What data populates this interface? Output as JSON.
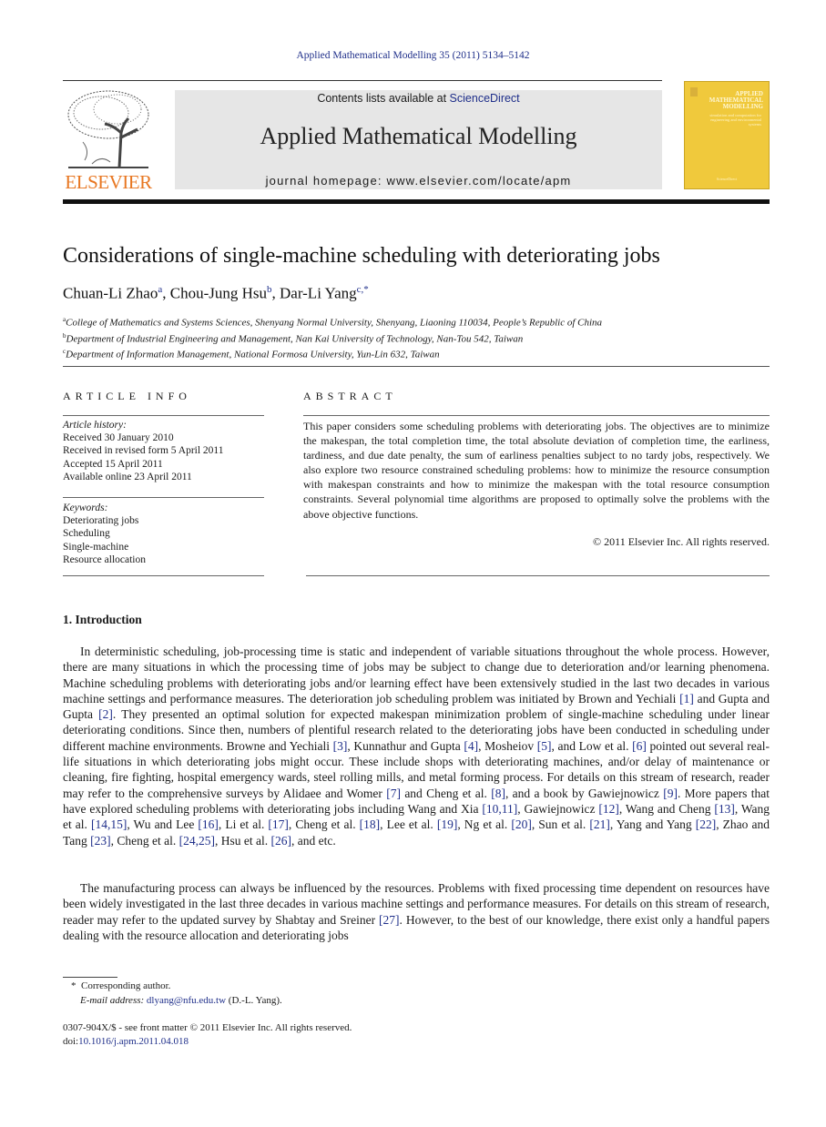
{
  "running_head": "Applied Mathematical Modelling 35 (2011) 5134–5142",
  "publisher_logo": {
    "text": "ELSEVIER",
    "icon": "elsevier-tree-icon",
    "color": "#e87722"
  },
  "banner": {
    "contents_prefix": "Contents lists available at ",
    "contents_link": "ScienceDirect",
    "journal_title": "Applied Mathematical Modelling",
    "homepage": "journal homepage: www.elsevier.com/locate/apm"
  },
  "cover": {
    "title": "APPLIED MATHEMATICAL MODELLING",
    "subtitle": "simulation and computation for engineering and environmental systems",
    "publisher": "ScienceDirect",
    "color": "#f0c93c"
  },
  "article": {
    "title": "Considerations of single-machine scheduling with deteriorating jobs",
    "authors": [
      {
        "name": "Chuan-Li Zhao",
        "sup": "a"
      },
      {
        "name": "Chou-Jung Hsu",
        "sup": "b"
      },
      {
        "name": "Dar-Li Yang",
        "sup": "c,*"
      }
    ],
    "affiliations": [
      {
        "sup": "a",
        "text": "College of Mathematics and Systems Sciences, Shenyang Normal University, Shenyang, Liaoning 110034, People’s Republic of China"
      },
      {
        "sup": "b",
        "text": "Department of Industrial Engineering and Management, Nan Kai University of Technology, Nan-Tou 542, Taiwan"
      },
      {
        "sup": "c",
        "text": "Department of Information Management, National Formosa University, Yun-Lin 632, Taiwan"
      }
    ]
  },
  "article_info": {
    "heading": "ARTICLE INFO",
    "history_label": "Article history:",
    "history": [
      "Received 30 January 2010",
      "Received in revised form 5 April 2011",
      "Accepted 15 April 2011",
      "Available online 23 April 2011"
    ],
    "keywords_label": "Keywords:",
    "keywords": [
      "Deteriorating jobs",
      "Scheduling",
      "Single-machine",
      "Resource allocation"
    ]
  },
  "abstract": {
    "heading": "ABSTRACT",
    "text": "This paper considers some scheduling problems with deteriorating jobs. The objectives are to minimize the makespan, the total completion time, the total absolute deviation of completion time, the earliness, tardiness, and due date penalty, the sum of earliness penalties subject to no tardy jobs, respectively. We also explore two resource constrained scheduling problems: how to minimize the resource consumption with makespan constraints and how to minimize the makespan with the total resource consumption constraints. Several polynomial time algorithms are proposed to optimally solve the problems with the above objective functions.",
    "copyright": "© 2011 Elsevier Inc. All rights reserved."
  },
  "introduction": {
    "heading": "1. Introduction",
    "para1": [
      {
        "t": "In deterministic scheduling, job-processing time is static and independent of variable situations throughout the whole process. However, there are many situations in which the processing time of jobs may be subject to change due to deterioration and/or learning phenomena. Machine scheduling problems with deteriorating jobs and/or learning effect have been extensively studied in the last two decades in various machine settings and performance measures. The deterioration job scheduling problem was initiated by Brown and Yechiali "
      },
      {
        "ref": "[1]"
      },
      {
        "t": " and Gupta and Gupta "
      },
      {
        "ref": "[2]"
      },
      {
        "t": ". They presented an optimal solution for expected makespan minimization problem of single-machine scheduling under linear deteriorating conditions. Since then, numbers of plentiful research related to the deteriorating jobs have been conducted in scheduling under different machine environments. Browne and Yechiali "
      },
      {
        "ref": "[3]"
      },
      {
        "t": ", Kunnathur and Gupta "
      },
      {
        "ref": "[4]"
      },
      {
        "t": ", Mosheiov "
      },
      {
        "ref": "[5]"
      },
      {
        "t": ", and Low et al. "
      },
      {
        "ref": "[6]"
      },
      {
        "t": " pointed out several real-life situations in which deteriorating jobs might occur. These include shops with deteriorating machines, and/or delay of maintenance or cleaning, fire fighting, hospital emergency wards, steel rolling mills, and metal forming process. For details on this stream of research, reader may refer to the comprehensive surveys by Alidaee and Womer "
      },
      {
        "ref": "[7]"
      },
      {
        "t": " and Cheng et al. "
      },
      {
        "ref": "[8]"
      },
      {
        "t": ", and a book by Gawiejnowicz "
      },
      {
        "ref": "[9]"
      },
      {
        "t": ". More papers that have explored scheduling problems with deteriorating jobs including Wang and Xia "
      },
      {
        "ref": "[10,11]"
      },
      {
        "t": ", Gawiejnowicz "
      },
      {
        "ref": "[12]"
      },
      {
        "t": ", Wang and Cheng "
      },
      {
        "ref": "[13]"
      },
      {
        "t": ", Wang et al. "
      },
      {
        "ref": "[14,15]"
      },
      {
        "t": ", Wu and Lee "
      },
      {
        "ref": "[16]"
      },
      {
        "t": ", Li et al. "
      },
      {
        "ref": "[17]"
      },
      {
        "t": ", Cheng et al. "
      },
      {
        "ref": "[18]"
      },
      {
        "t": ", Lee et al. "
      },
      {
        "ref": "[19]"
      },
      {
        "t": ", Ng et al. "
      },
      {
        "ref": "[20]"
      },
      {
        "t": ", Sun et al. "
      },
      {
        "ref": "[21]"
      },
      {
        "t": ", Yang and Yang "
      },
      {
        "ref": "[22]"
      },
      {
        "t": ", Zhao and Tang "
      },
      {
        "ref": "[23]"
      },
      {
        "t": ", Cheng et al. "
      },
      {
        "ref": "[24,25]"
      },
      {
        "t": ", Hsu et al. "
      },
      {
        "ref": "[26]"
      },
      {
        "t": ", and etc."
      }
    ],
    "para2": [
      {
        "t": "The manufacturing process can always be influenced by the resources. Problems with fixed processing time dependent on resources have been widely investigated in the last three decades in various machine settings and performance measures. For details on this stream of research, reader may refer to the updated survey by Shabtay and Sreiner "
      },
      {
        "ref": "[27]"
      },
      {
        "t": ". However, to the best of our knowledge, there exist only a handful papers dealing with the resource allocation and deteriorating jobs"
      }
    ]
  },
  "footnote": {
    "marker": "*",
    "corresponding": "Corresponding author.",
    "email_label": "E-mail address:",
    "email": "dlyang@nfu.edu.tw",
    "email_suffix": " (D.-L. Yang)."
  },
  "bottom_meta": {
    "issn_line": "0307-904X/$ - see front matter © 2011 Elsevier Inc. All rights reserved.",
    "doi_prefix": "doi:",
    "doi": "10.1016/j.apm.2011.04.018"
  }
}
